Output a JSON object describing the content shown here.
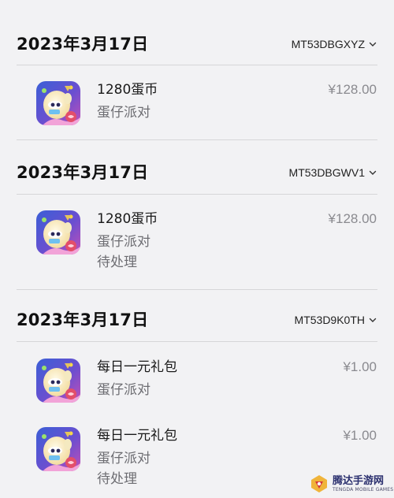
{
  "orders": [
    {
      "date": "2023年3月17日",
      "order_id": "MT53DBGXYZ",
      "items": [
        {
          "title": "1280蛋币",
          "subtitle": "蛋仔派对",
          "status": "",
          "price": "¥128.00",
          "icon": "egg-party-app-icon"
        }
      ]
    },
    {
      "date": "2023年3月17日",
      "order_id": "MT53DBGWV1",
      "items": [
        {
          "title": "1280蛋币",
          "subtitle": "蛋仔派对",
          "status": "待处理",
          "price": "¥128.00",
          "icon": "egg-party-app-icon"
        }
      ]
    },
    {
      "date": "2023年3月17日",
      "order_id": "MT53D9K0TH",
      "items": [
        {
          "title": "每日一元礼包",
          "subtitle": "蛋仔派对",
          "status": "",
          "price": "¥1.00",
          "icon": "egg-party-app-icon"
        },
        {
          "title": "每日一元礼包",
          "subtitle": "蛋仔派对",
          "status": "待处理",
          "price": "¥1.00",
          "icon": "egg-party-app-icon"
        }
      ]
    }
  ],
  "watermark": {
    "text": "腾达手游网",
    "sub": "TENGDA MOBILE GAMES",
    "icon": "tengda-logo-icon"
  },
  "colors": {
    "background": "#f2f2f4",
    "divider": "#d6d6d8",
    "secondary_text": "#6d6d72",
    "price_text": "#8a8a8f"
  }
}
